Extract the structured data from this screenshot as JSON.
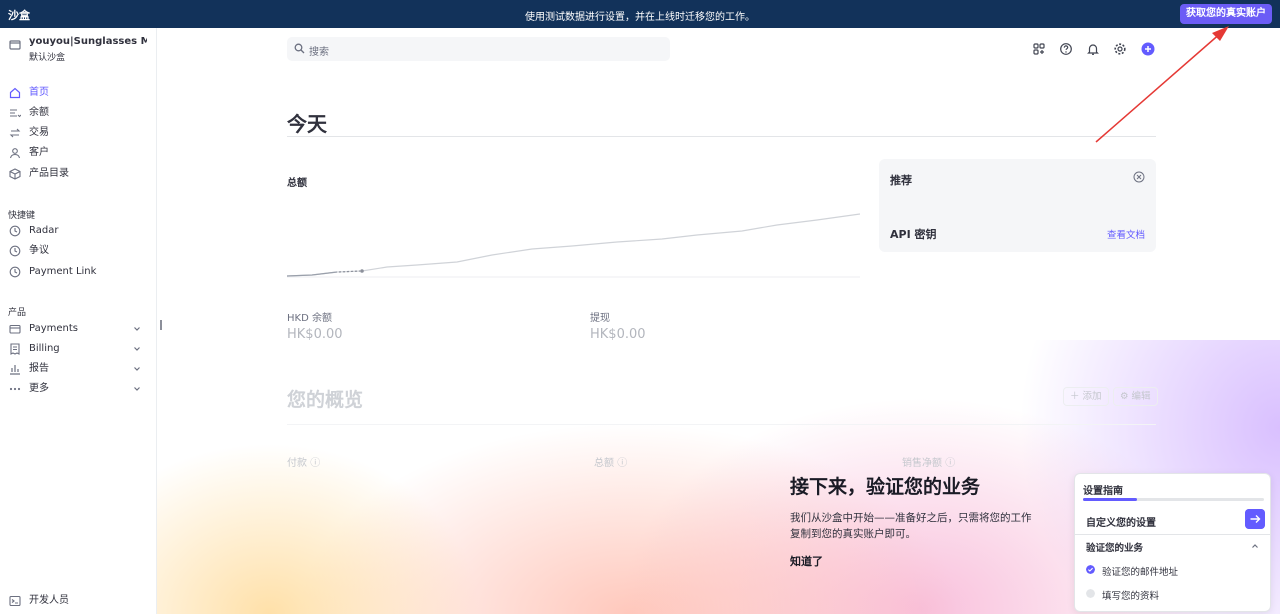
{
  "banner": {
    "brand": "沙盒",
    "message": "使用测试数据进行设置，并在上线时迁移您的工作。",
    "live_button": "获取您的真实账户"
  },
  "account": {
    "name": "youyou|Sunglasses M...",
    "subtitle": "默认沙盒"
  },
  "nav": {
    "main": [
      {
        "label": "首页",
        "icon": "home-icon"
      },
      {
        "label": "余额",
        "icon": "balance-icon"
      },
      {
        "label": "交易",
        "icon": "transactions-icon"
      },
      {
        "label": "客户",
        "icon": "customer-icon"
      },
      {
        "label": "产品目录",
        "icon": "product-catalog-icon"
      }
    ],
    "shortcuts_title": "快捷键",
    "shortcuts": [
      {
        "label": "Radar",
        "icon": "clock-icon"
      },
      {
        "label": "争议",
        "icon": "clock-icon"
      },
      {
        "label": "Payment Link",
        "icon": "clock-icon"
      }
    ],
    "products_title": "产品",
    "products": [
      {
        "label": "Payments",
        "icon": "payments-icon"
      },
      {
        "label": "Billing",
        "icon": "billing-icon"
      },
      {
        "label": "报告",
        "icon": "reports-icon"
      },
      {
        "label": "更多",
        "icon": "more-icon"
      }
    ],
    "developer": "开发人员"
  },
  "search": {
    "placeholder": "搜索"
  },
  "main": {
    "title": "今天",
    "total_label": "总额",
    "balance_label": "HKD 余额",
    "balance_value": "HK$0.00",
    "payout_label": "提现",
    "payout_value": "HK$0.00"
  },
  "recommend": {
    "title": "推荐",
    "api_label": "API 密钥",
    "docs_link": "查看文档"
  },
  "overview": {
    "title": "您的概览",
    "add": "添加",
    "edit": "编辑",
    "metrics": [
      "付款",
      "总额",
      "销售净额"
    ]
  },
  "verify": {
    "title": "接下来，验证您的业务",
    "desc": "我们从沙盒中开始——准备好之后，只需将您的工作复制到您的真实账户即可。",
    "ok": "知道了"
  },
  "guide": {
    "title": "设置指南",
    "progress": 0.3,
    "current_step": "自定义您的设置",
    "section": "验证您的业务",
    "items": [
      {
        "label": "验证您的邮件地址",
        "done": true
      },
      {
        "label": "填写您的资料",
        "done": false
      }
    ]
  },
  "colors": {
    "accent": "#635bff",
    "banner": "#12325a",
    "annotation": "#e53935"
  }
}
